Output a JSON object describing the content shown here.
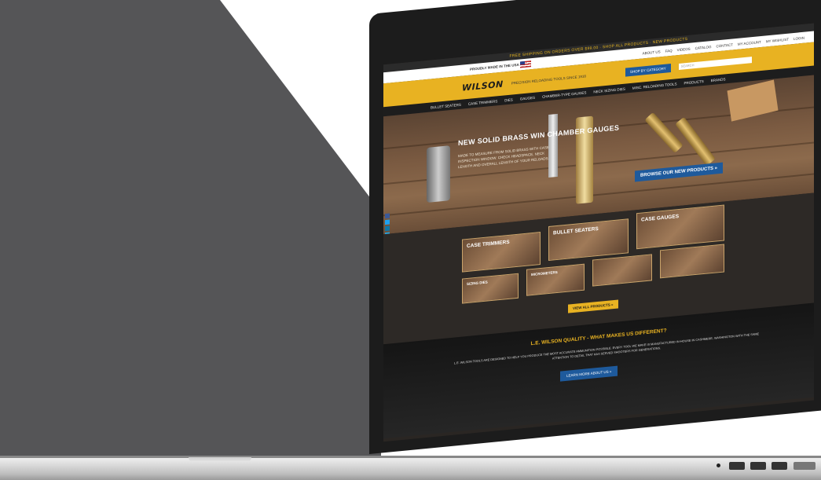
{
  "colors": {
    "background": "#ffffff",
    "dark_panel": "#555557",
    "brand_yellow": "#e8b222",
    "brand_blue": "#1e5a9c",
    "nav_dark": "#1d1d1d"
  },
  "website": {
    "topbar_text": "FREE SHIPPING ON ORDERS OVER $99.00 · SHOP ALL PRODUCTS · NEW PRODUCTS",
    "utility": {
      "made_in_usa": "PROUDLY MADE IN THE USA",
      "links": [
        "ABOUT US",
        "FAQ",
        "VIDEOS",
        "CATALOG",
        "CONTACT",
        "MY ACCOUNT",
        "MY WISHLIST",
        "LOGIN"
      ]
    },
    "header": {
      "logo": "WILSON",
      "tagline": "PRECISION RELOADING TOOLS SINCE 1918",
      "shop_button": "SHOP BY CATEGORY",
      "search_placeholder": "SEARCH"
    },
    "nav": [
      "BULLET SEATERS",
      "CASE TRIMMERS",
      "DIES",
      "GAUGES",
      "CHAMBER-TYPE GAUGES",
      "NECK SIZING DIES",
      "MISC. RELOADING TOOLS",
      "PRODUCTS",
      "BRANDS"
    ],
    "hero": {
      "title": "NEW SOLID BRASS WIN CHAMBER GAUGES",
      "text": "MADE TO MEASURE FROM SOLID BRASS WITH CASE INSPECTION WINDOW. CHECK HEADSPACE, NECK LENGTH AND OVERALL LENGTH OF YOUR RELOADS.",
      "cta": "BROWSE OUR NEW PRODUCTS »"
    },
    "categories": [
      {
        "label": "CASE TRIMMERS"
      },
      {
        "label": "BULLET SEATERS"
      },
      {
        "label": "CASE GAUGES"
      },
      {
        "label": "SIZING DIES"
      },
      {
        "label": "MICROMETERS"
      },
      {
        "label": ""
      },
      {
        "label": ""
      }
    ],
    "view_all": "VIEW ALL PRODUCTS »",
    "about": {
      "title": "L.E. WILSON QUALITY - WHAT MAKES US DIFFERENT?",
      "text": "L.E. WILSON TOOLS ARE DESIGNED TO HELP YOU PRODUCE THE MOST ACCURATE AMMUNITION POSSIBLE. EVERY TOOL WE MAKE IS MANUFACTURED IN-HOUSE IN CASHMERE, WASHINGTON WITH THE SAME ATTENTION TO DETAIL THAT HAS SERVED SHOOTERS FOR GENERATIONS.",
      "button": "LEARN MORE ABOUT US »"
    }
  }
}
